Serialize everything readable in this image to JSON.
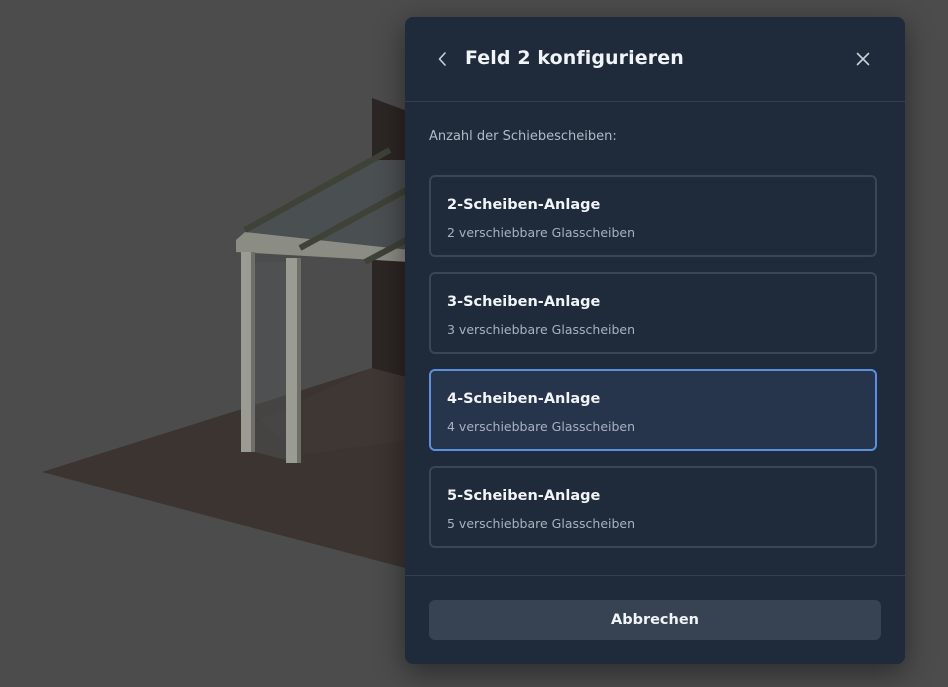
{
  "background": {
    "scene_colors": {
      "backdrop": "#4c4c4c",
      "floor": "#3a3330",
      "wall": "#2b2624",
      "frame": "#8f9088",
      "glass": "#4d5254"
    }
  },
  "dialog": {
    "title": "Feld 2 konfigurieren",
    "back_icon": "chevron-left-icon",
    "close_icon": "close-icon",
    "section_label": "Anzahl der Schiebescheiben:",
    "options": [
      {
        "title": "2-Scheiben-Anlage",
        "subtitle": "2 verschiebbare Glasscheiben",
        "selected": false
      },
      {
        "title": "3-Scheiben-Anlage",
        "subtitle": "3 verschiebbare Glasscheiben",
        "selected": false
      },
      {
        "title": "4-Scheiben-Anlage",
        "subtitle": "4 verschiebbare Glasscheiben",
        "selected": true
      },
      {
        "title": "5-Scheiben-Anlage",
        "subtitle": "5 verschiebbare Glasscheiben",
        "selected": false
      }
    ],
    "cancel_label": "Abbrechen",
    "accent_color": "#5b8fe0"
  }
}
